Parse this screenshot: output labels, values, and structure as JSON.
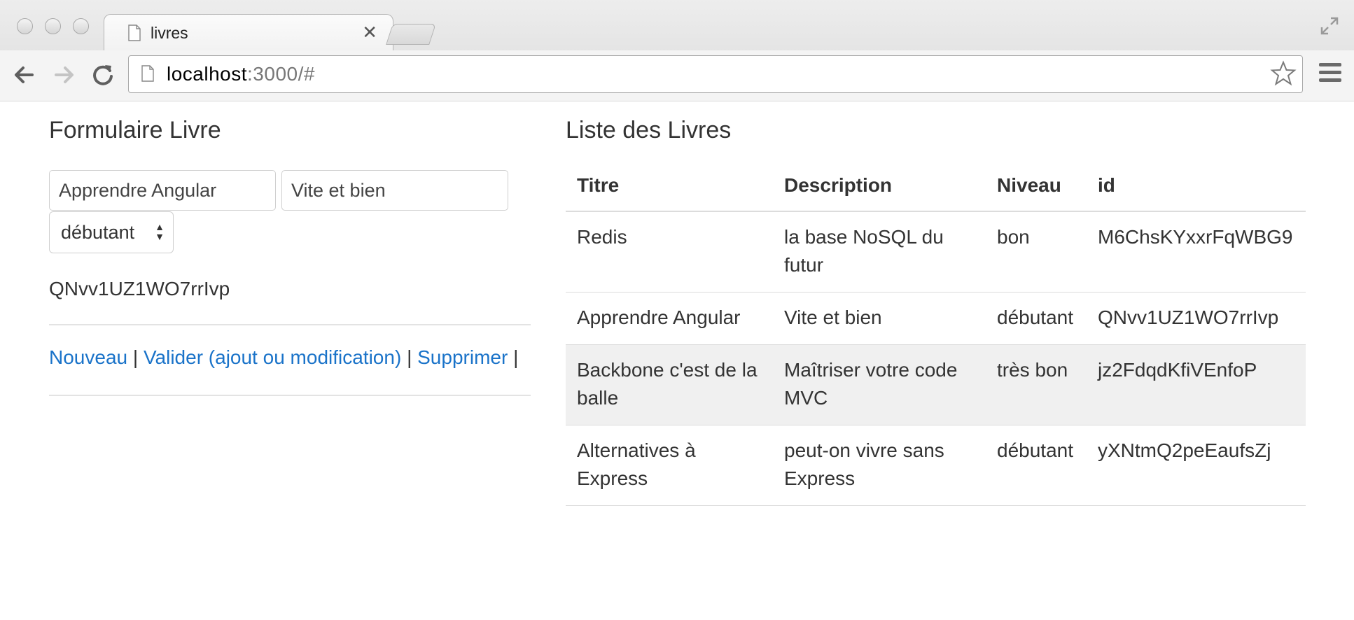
{
  "browser": {
    "tab_title": "livres",
    "url_host": "localhost",
    "url_rest": ":3000/#"
  },
  "form": {
    "heading": "Formulaire Livre",
    "title_value": "Apprendre Angular",
    "description_value": "Vite et bien",
    "level_selected": "débutant",
    "current_id": "QNvv1UZ1WO7rrIvp",
    "actions": {
      "new_label": "Nouveau",
      "validate_label": "Valider (ajout ou modification)",
      "delete_label": "Supprimer",
      "separator": "|"
    }
  },
  "list": {
    "heading": "Liste des Livres",
    "columns": [
      "Titre",
      "Description",
      "Niveau",
      "id"
    ],
    "rows": [
      {
        "titre": "Redis",
        "description": "la base NoSQL du futur",
        "niveau": "bon",
        "id": "M6ChsKYxxrFqWBG9"
      },
      {
        "titre": "Apprendre Angular",
        "description": "Vite et bien",
        "niveau": "débutant",
        "id": "QNvv1UZ1WO7rrIvp"
      },
      {
        "titre": "Backbone c'est de la balle",
        "description": "Maîtriser votre code MVC",
        "niveau": "très bon",
        "id": "jz2FdqdKfiVEnfoP"
      },
      {
        "titre": "Alternatives à Express",
        "description": "peut-on vivre sans Express",
        "niveau": "débutant",
        "id": "yXNtmQ2peEaufsZj"
      }
    ],
    "highlighted_row": 2
  },
  "colors": {
    "link": "#1a73c9",
    "row_highlight": "#f0f0f0"
  }
}
